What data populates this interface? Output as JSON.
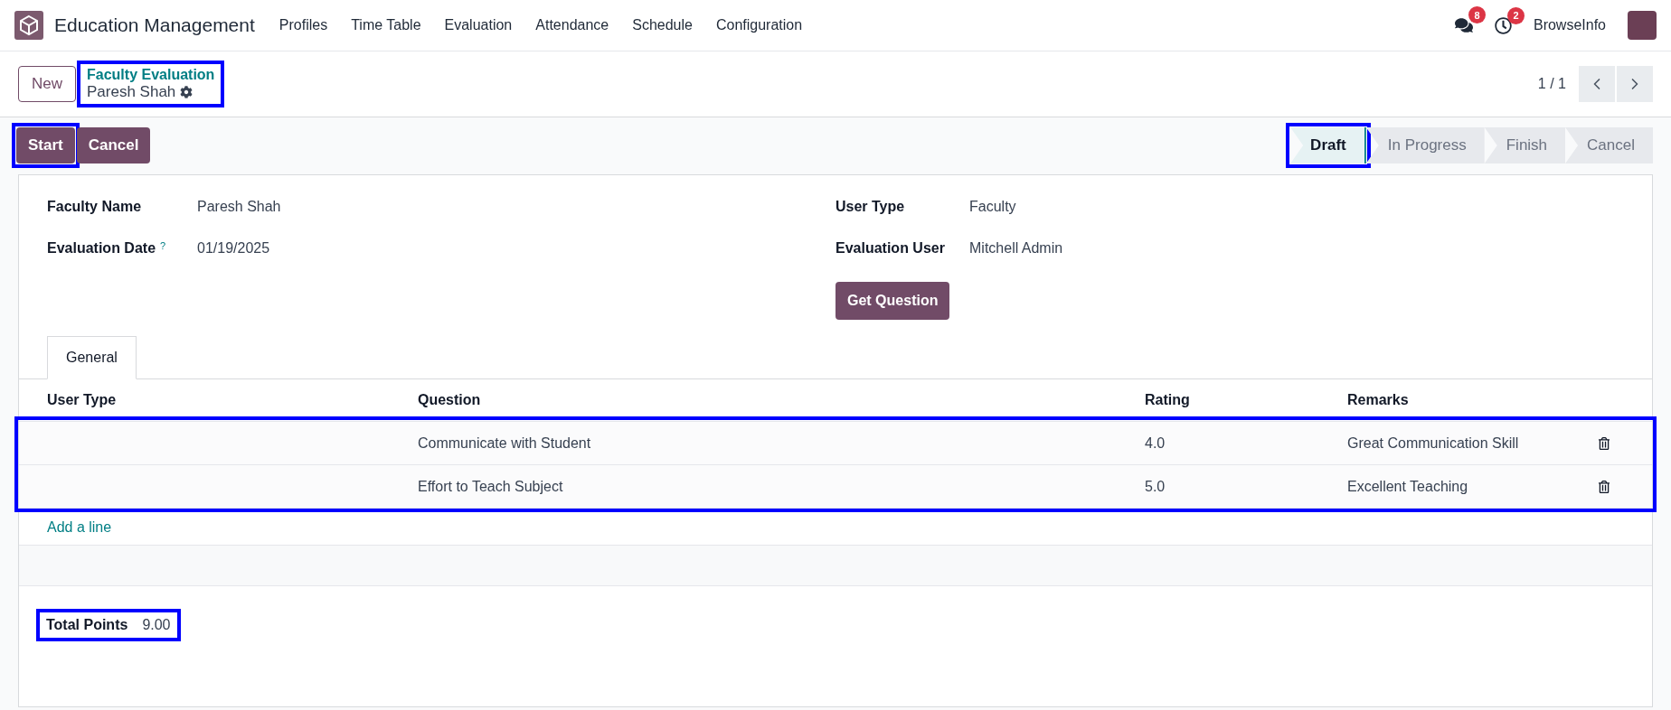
{
  "app": {
    "title": "Education Management",
    "menu": [
      "Profiles",
      "Time Table",
      "Evaluation",
      "Attendance",
      "Schedule",
      "Configuration"
    ],
    "messages_count": "8",
    "activities_count": "2",
    "user": "BrowseInfo"
  },
  "breadcrumb": {
    "new_button": "New",
    "parent": "Faculty Evaluation",
    "current": "Paresh Shah",
    "highlighted": true
  },
  "pager": {
    "text": "1 / 1"
  },
  "actions": [
    {
      "label": "Start",
      "highlighted": true
    },
    {
      "label": "Cancel",
      "highlighted": false
    }
  ],
  "stages": [
    {
      "label": "Draft",
      "selected": true,
      "highlighted": true
    },
    {
      "label": "In Progress",
      "selected": false,
      "highlighted": false
    },
    {
      "label": "Finish",
      "selected": false,
      "highlighted": false
    },
    {
      "label": "Cancel",
      "selected": false,
      "highlighted": false
    }
  ],
  "fields_left": [
    {
      "label": "Faculty Name",
      "value": "Paresh Shah"
    },
    {
      "label": "Evaluation Date",
      "value": "01/19/2025",
      "help": "?"
    }
  ],
  "fields_right": [
    {
      "label": "User Type",
      "value": "Faculty"
    },
    {
      "label": "Evaluation User",
      "value": "Mitchell Admin"
    }
  ],
  "get_question_button": "Get Question",
  "tabs": [
    {
      "label": "General",
      "selected": true
    }
  ],
  "table": {
    "columns": [
      "User Type",
      "Question",
      "Rating",
      "Remarks"
    ],
    "highlighted": true,
    "rows": [
      {
        "question": "Communicate with Student",
        "rating": "4.0",
        "remarks": "Great Communication Skill"
      },
      {
        "question": "Effort to Teach Subject",
        "rating": "5.0",
        "remarks": "Excellent Teaching"
      }
    ],
    "add_line": "Add a line"
  },
  "total": {
    "label": "Total Points",
    "value": "9.00",
    "highlighted": true
  }
}
